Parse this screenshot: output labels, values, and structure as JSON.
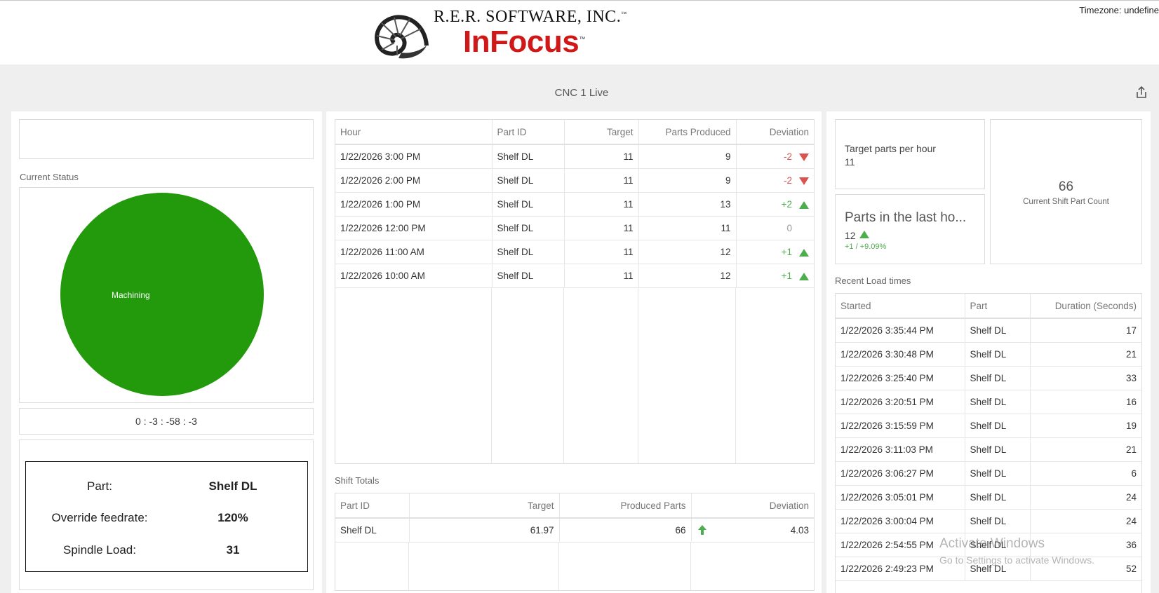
{
  "header": {
    "timezone": "Timezone: undefine",
    "company": "R.E.R. SOFTWARE, INC.",
    "product": "InFocus",
    "tm": "™"
  },
  "dashboard": {
    "title": "CNC 1 Live"
  },
  "left": {
    "current_status_caption": "Current Status",
    "pie": {
      "label": "Machining",
      "color": "#229a0b"
    },
    "timer": "0 : -3 : -58 : -3",
    "info": [
      {
        "label": "Part:",
        "value": "Shelf DL"
      },
      {
        "label": "Override feedrate:",
        "value": "120%"
      },
      {
        "label": "Spindle Load:",
        "value": "31"
      }
    ]
  },
  "hourly": {
    "headers": [
      "Hour",
      "Part ID",
      "Target",
      "Parts Produced",
      "Deviation"
    ],
    "rows": [
      {
        "hour": "1/22/2026 3:00 PM",
        "part": "Shelf DL",
        "target": "11",
        "produced": "9",
        "deviation": "-2",
        "trend": "down"
      },
      {
        "hour": "1/22/2026 2:00 PM",
        "part": "Shelf DL",
        "target": "11",
        "produced": "9",
        "deviation": "-2",
        "trend": "down"
      },
      {
        "hour": "1/22/2026 1:00 PM",
        "part": "Shelf DL",
        "target": "11",
        "produced": "13",
        "deviation": "+2",
        "trend": "up"
      },
      {
        "hour": "1/22/2026 12:00 PM",
        "part": "Shelf DL",
        "target": "11",
        "produced": "11",
        "deviation": "0",
        "trend": "none"
      },
      {
        "hour": "1/22/2026 11:00 AM",
        "part": "Shelf DL",
        "target": "11",
        "produced": "12",
        "deviation": "+1",
        "trend": "up"
      },
      {
        "hour": "1/22/2026 10:00 AM",
        "part": "Shelf DL",
        "target": "11",
        "produced": "12",
        "deviation": "+1",
        "trend": "up"
      }
    ]
  },
  "shift_totals": {
    "caption": "Shift Totals",
    "headers": [
      "Part ID",
      "Target",
      "Produced Parts",
      "Deviation"
    ],
    "rows": [
      {
        "part": "Shelf DL",
        "target": "61.97",
        "produced": "66",
        "deviation": "4.03",
        "trend": "up"
      }
    ]
  },
  "kpi": {
    "target_label": "Target parts per hour",
    "target_value": "11",
    "last_hour_label": "Parts in the last ho...",
    "last_hour_value": "12",
    "last_hour_change": "+1 / +9.09%",
    "shift_count_value": "66",
    "shift_count_label": "Current Shift Part Count"
  },
  "load_times": {
    "caption": "Recent Load times",
    "headers": [
      "Started",
      "Part",
      "Duration (Seconds)"
    ],
    "rows": [
      {
        "started": "1/22/2026 3:35:44 PM",
        "part": "Shelf DL",
        "duration": "17"
      },
      {
        "started": "1/22/2026 3:30:48 PM",
        "part": "Shelf DL",
        "duration": "21"
      },
      {
        "started": "1/22/2026 3:25:40 PM",
        "part": "Shelf DL",
        "duration": "33"
      },
      {
        "started": "1/22/2026 3:20:51 PM",
        "part": "Shelf DL",
        "duration": "16"
      },
      {
        "started": "1/22/2026 3:15:59 PM",
        "part": "Shelf DL",
        "duration": "19"
      },
      {
        "started": "1/22/2026 3:11:03 PM",
        "part": "Shelf DL",
        "duration": "21"
      },
      {
        "started": "1/22/2026 3:06:27 PM",
        "part": "Shelf DL",
        "duration": "6"
      },
      {
        "started": "1/22/2026 3:05:01 PM",
        "part": "Shelf DL",
        "duration": "24"
      },
      {
        "started": "1/22/2026 3:00:04 PM",
        "part": "Shelf DL",
        "duration": "24"
      },
      {
        "started": "1/22/2026 2:54:55 PM",
        "part": "Shelf DL",
        "duration": "36"
      },
      {
        "started": "1/22/2026 2:49:23 PM",
        "part": "Shelf DL",
        "duration": "52"
      }
    ]
  },
  "watermark": {
    "line1": "Activate Windows",
    "line2": "Go to Settings to activate Windows."
  }
}
